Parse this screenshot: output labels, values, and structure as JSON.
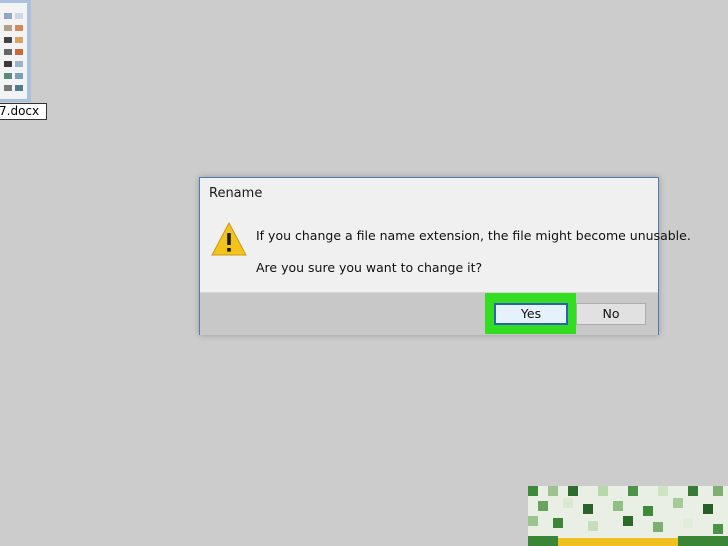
{
  "desktop": {
    "file_name": "7.docx"
  },
  "dialog": {
    "title": "Rename",
    "icon": "warning-icon",
    "message_line1": "If you change a file name extension, the file might become unusable.",
    "message_line2": "Are you sure you want to change it?",
    "yes_label": "Yes",
    "no_label": "No"
  },
  "colors": {
    "background": "#cccccc",
    "dialog_border": "#4a7cb8",
    "highlight": "#33dd22",
    "warning_yellow": "#f3c21b"
  }
}
